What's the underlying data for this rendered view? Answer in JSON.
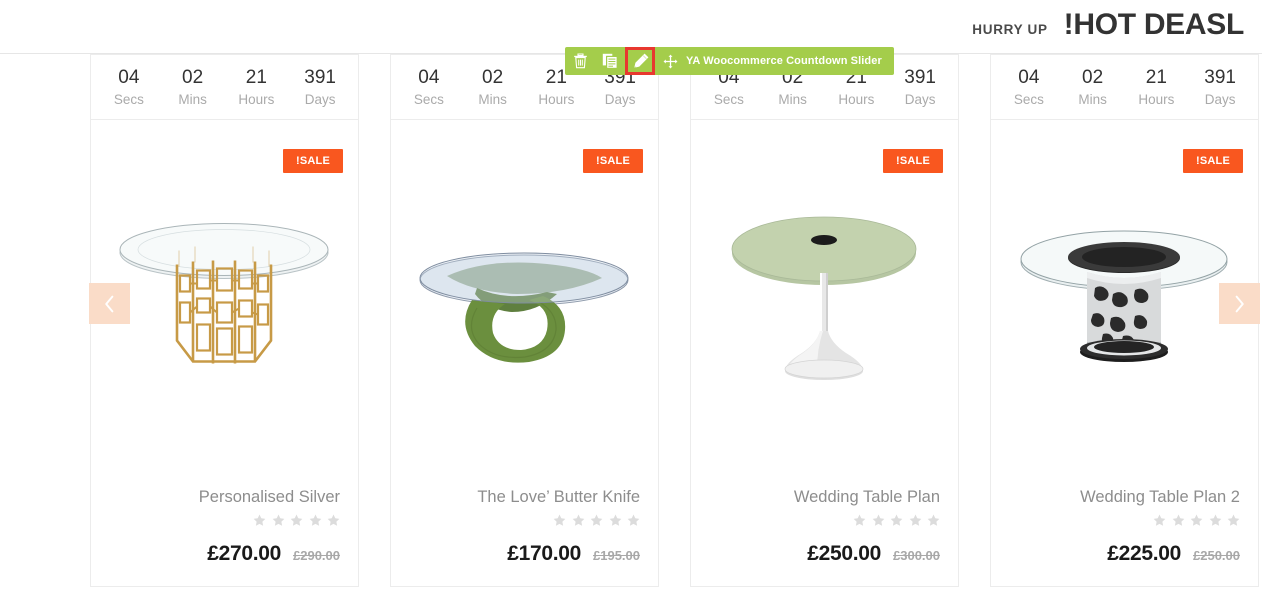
{
  "header": {
    "hurry_up": "HURRY UP",
    "hot_deals": "!HOT DEASL"
  },
  "builder_toolbar": {
    "label": "YA Woocommerce Countdown Slider",
    "background_color": "#a4cd4b",
    "selected_outline_color": "#e8382f",
    "buttons": [
      {
        "name": "delete-button",
        "icon": "trash-icon",
        "selected": false
      },
      {
        "name": "duplicate-button",
        "icon": "copy-icon",
        "selected": false
      },
      {
        "name": "edit-button",
        "icon": "pencil-icon",
        "selected": true
      },
      {
        "name": "drag-handle",
        "icon": "move-icon",
        "selected": false
      }
    ]
  },
  "slider": {
    "prev_label": "‹",
    "next_label": "›",
    "arrow_color": "#fadcc8",
    "sale_badge_color": "#f9571f",
    "countdown_units": [
      "Secs",
      "Mins",
      "Hours",
      "Days"
    ],
    "products": [
      {
        "countdown": [
          "04",
          "02",
          "21",
          "391"
        ],
        "badge": "!SALE",
        "title": "Personalised Silver",
        "rating": 0,
        "max_rating": 5,
        "price_new": "£270.00",
        "price_old": "£290.00",
        "image": "glass-round-table-gold-lattice-base"
      },
      {
        "countdown": [
          "04",
          "02",
          "21",
          "391"
        ],
        "badge": "!SALE",
        "title": "The Love’ Butter Knife",
        "rating": 0,
        "max_rating": 5,
        "price_new": "£170.00",
        "price_old": "£195.00",
        "image": "glass-oval-table-green-sculptural-base"
      },
      {
        "countdown": [
          "04",
          "02",
          "21",
          "391"
        ],
        "badge": "!SALE",
        "title": "Wedding Table Plan",
        "rating": 0,
        "max_rating": 5,
        "price_new": "£250.00",
        "price_old": "£300.00",
        "image": "green-round-pedestal-table-white-base"
      },
      {
        "countdown": [
          "04",
          "02",
          "21",
          "391"
        ],
        "badge": "!SALE",
        "title": "Wedding Table Plan 2",
        "rating": 0,
        "max_rating": 5,
        "price_new": "£225.00",
        "price_old": "£250.00",
        "image": "glass-round-table-chrome-lattice-base"
      }
    ]
  }
}
